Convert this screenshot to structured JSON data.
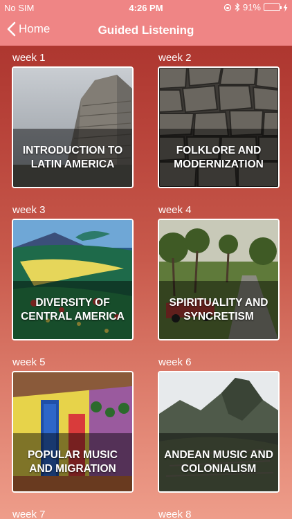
{
  "status_bar": {
    "carrier": "No SIM",
    "time": "4:26 PM",
    "battery": "91%",
    "battery_level": 0.91
  },
  "nav": {
    "back_label": "Home",
    "title": "Guided Listening"
  },
  "weeks": [
    {
      "label": "week 1",
      "title": "INTRODUCTION TO\nLATIN AMERICA"
    },
    {
      "label": "week 2",
      "title": "FOLKLORE AND\nMODERNIZATION"
    },
    {
      "label": "week 3",
      "title": "DIVERSITY OF\nCENTRAL AMERICA"
    },
    {
      "label": "week 4",
      "title": "SPIRITUALITY AND\nSYNCRETISM"
    },
    {
      "label": "week 5",
      "title": "POPULAR MUSIC\nAND MIGRATION"
    },
    {
      "label": "week 6",
      "title": "ANDEAN MUSIC AND\nCOLONIALISM"
    },
    {
      "label": "week 7",
      "title": ""
    },
    {
      "label": "week 8",
      "title": ""
    }
  ]
}
